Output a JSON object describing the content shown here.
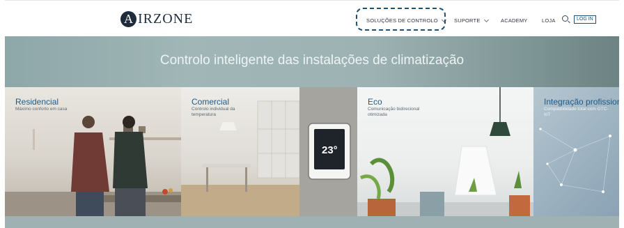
{
  "header": {
    "logo_letter": "A",
    "logo_text": "IRZONE",
    "nav": [
      {
        "label": "SOLUÇÕES DE CONTROLO",
        "has_dropdown": true
      },
      {
        "label": "SUPORTE",
        "has_dropdown": true
      },
      {
        "label": "ACADEMY",
        "has_dropdown": false
      },
      {
        "label": "LOJA",
        "has_dropdown": false
      }
    ],
    "login_label": "LOG IN"
  },
  "hero": {
    "title": "Controlo inteligente das instalações de climatização"
  },
  "cards": [
    {
      "title": "Residencial",
      "subtitle": "Máximo conforto em casa"
    },
    {
      "title": "Comercial",
      "subtitle": "Controlo individual da temperatura"
    },
    {
      "title": "Eco",
      "subtitle": "Comunicação bidirecional otimizada"
    },
    {
      "title": "Integração profissional",
      "subtitle": "Compatibilidade total com GTC-IoT"
    }
  ],
  "thermostat": {
    "temperature": "23°"
  },
  "colors": {
    "brand": "#1d2b3a",
    "accent": "#1e5a86",
    "highlight": "#1b4f73"
  }
}
